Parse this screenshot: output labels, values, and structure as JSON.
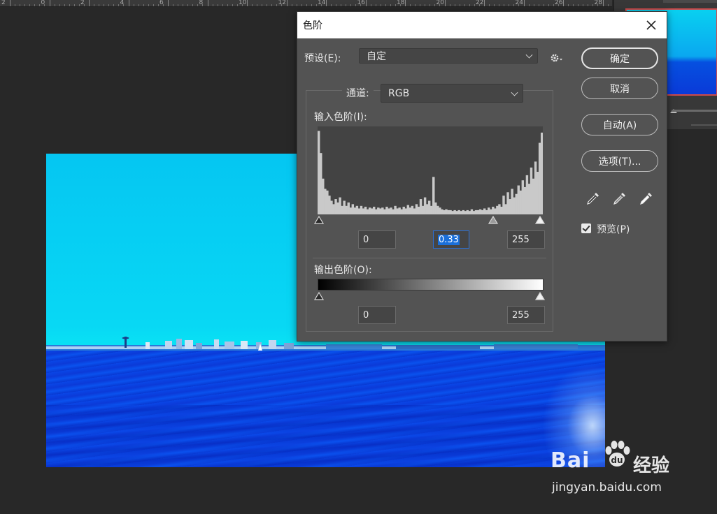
{
  "ruler": {
    "numbers": [
      "2",
      "0",
      "2",
      "4",
      "6",
      "8",
      "10",
      "12",
      "14",
      "16",
      "18",
      "20",
      "22",
      "24",
      "26",
      "28"
    ]
  },
  "dialog": {
    "title": "色阶",
    "preset_label": "预设(E):",
    "preset_value": "自定",
    "channel_label": "通道:",
    "channel_value": "RGB",
    "input_levels_label": "输入色阶(I):",
    "input_black": "0",
    "input_gamma": "0.33",
    "input_white": "255",
    "output_levels_label": "输出色阶(O):",
    "output_black": "0",
    "output_white": "255",
    "buttons": {
      "ok": "确定",
      "cancel": "取消",
      "auto": "自动(A)",
      "options": "选项(T)..."
    },
    "preview_label": "预览(P)",
    "preview_checked": true,
    "eyedroppers": [
      "black-point-eyedropper-icon",
      "gray-point-eyedropper-icon",
      "white-point-eyedropper-icon"
    ]
  },
  "histogram": {
    "bins": [
      0.98,
      0.72,
      0.42,
      0.3,
      0.28,
      0.22,
      0.16,
      0.12,
      0.18,
      0.14,
      0.2,
      0.1,
      0.16,
      0.1,
      0.14,
      0.08,
      0.12,
      0.08,
      0.1,
      0.07,
      0.1,
      0.07,
      0.09,
      0.06,
      0.08,
      0.07,
      0.09,
      0.06,
      0.08,
      0.07,
      0.08,
      0.06,
      0.09,
      0.07,
      0.08,
      0.06,
      0.1,
      0.07,
      0.08,
      0.06,
      0.09,
      0.07,
      0.11,
      0.08,
      0.1,
      0.07,
      0.12,
      0.09,
      0.18,
      0.1,
      0.2,
      0.12,
      0.16,
      0.1,
      0.44,
      0.14,
      0.1,
      0.08,
      0.06,
      0.05,
      0.06,
      0.05,
      0.05,
      0.04,
      0.05,
      0.04,
      0.05,
      0.04,
      0.05,
      0.04,
      0.05,
      0.04,
      0.06,
      0.04,
      0.05,
      0.05,
      0.06,
      0.05,
      0.07,
      0.05,
      0.08,
      0.06,
      0.09,
      0.07,
      0.1,
      0.12,
      0.09,
      0.22,
      0.12,
      0.26,
      0.18,
      0.3,
      0.2,
      0.24,
      0.34,
      0.28,
      0.4,
      0.32,
      0.46,
      0.36,
      0.55,
      0.42,
      0.62,
      0.5,
      0.84,
      0.96
    ],
    "gamma_position_fraction": 0.78
  },
  "watermark": {
    "brand": "Bai",
    "brand_cn": "经验",
    "url": "jingyan.baidu.com"
  }
}
